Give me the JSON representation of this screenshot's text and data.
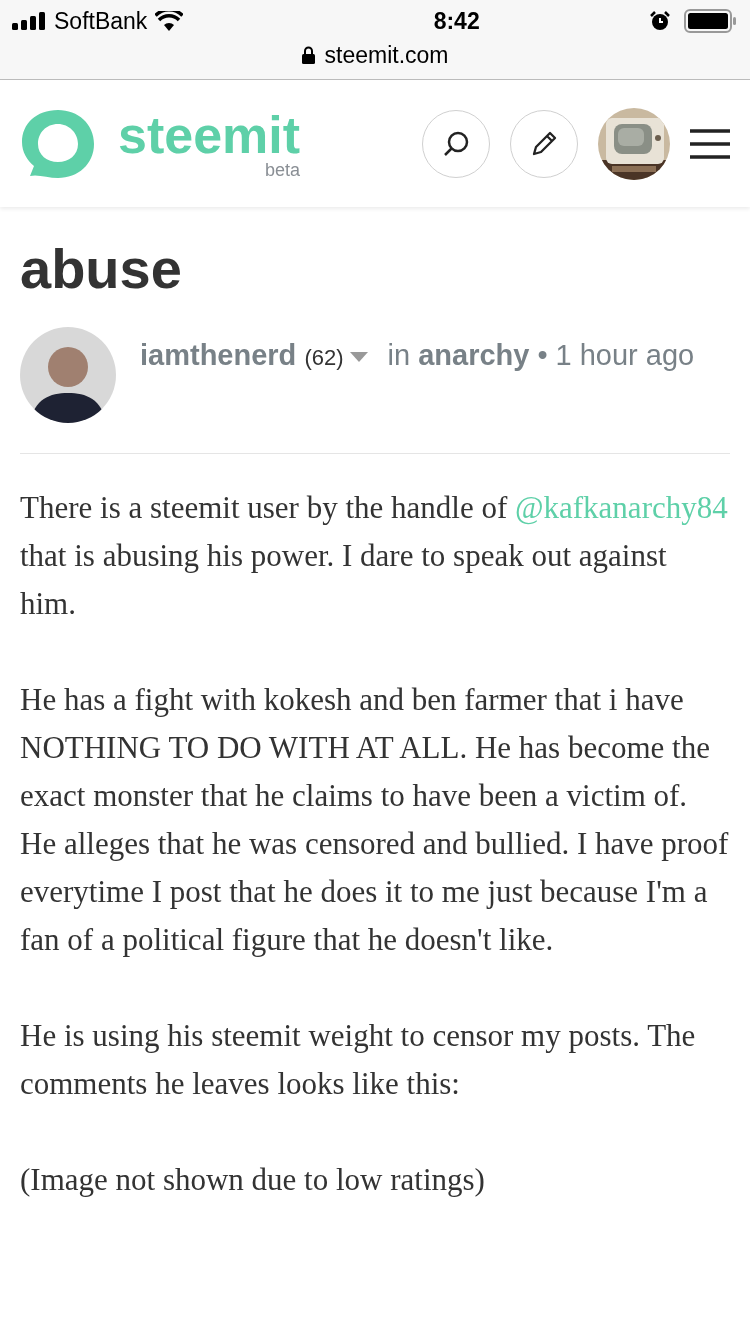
{
  "status_bar": {
    "carrier": "SoftBank",
    "time": "8:42",
    "url": "steemit.com"
  },
  "header": {
    "logo_text": "steemit",
    "logo_sub": "beta"
  },
  "post": {
    "title_visible": "abuse",
    "author": {
      "name": "iamthenerd",
      "reputation": "(62)",
      "in": "in",
      "category": "anarchy",
      "separator": "•",
      "time": "1 hour ago"
    },
    "body": [
      {
        "parts": [
          {
            "kind": "text",
            "text": "There is a steemit user by the handle of "
          },
          {
            "kind": "link",
            "text": "@kafkanarchy84"
          },
          {
            "kind": "text",
            "text": " that is abusing his power. I dare to speak out against him."
          }
        ]
      },
      {
        "parts": [
          {
            "kind": "text",
            "text": "He has a fight with kokesh and ben farmer that i have NOTHING TO DO WITH AT ALL. He has become the exact monster that he claims to have been a victim of. He alleges that he was censored and bullied. I have proof everytime I post that he does it to me just because I'm a fan of a political figure that he doesn't like."
          }
        ]
      },
      {
        "parts": [
          {
            "kind": "text",
            "text": "He is using his steemit weight to censor my posts. The comments he leaves looks like this:"
          }
        ]
      },
      {
        "parts": [
          {
            "kind": "text",
            "text": "(Image not shown due to low ratings)"
          }
        ]
      }
    ]
  }
}
